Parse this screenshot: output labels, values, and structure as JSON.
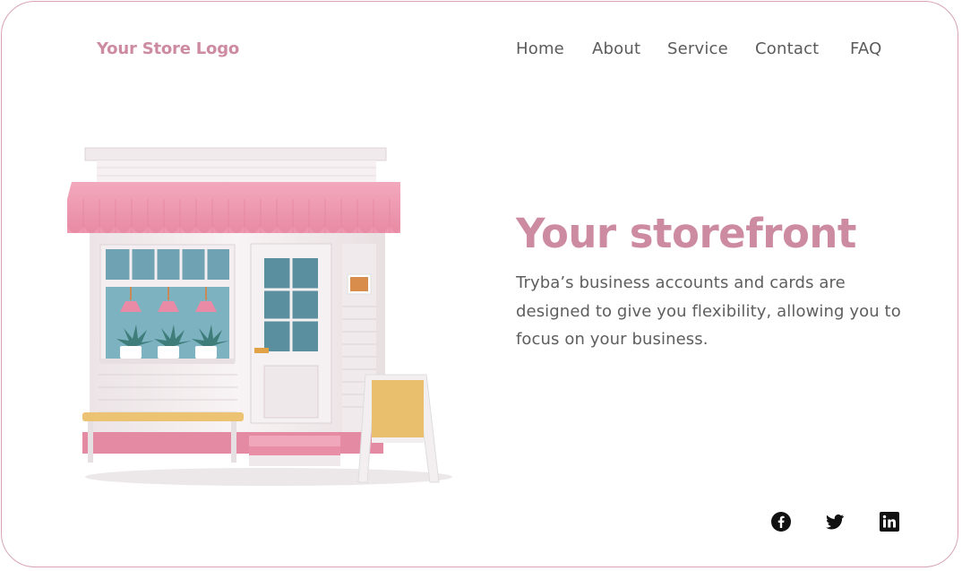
{
  "brand": {
    "logo_text": "Your Store Logo",
    "accent": "#cd8ba1"
  },
  "nav": {
    "items": [
      {
        "label": "Home"
      },
      {
        "label": "About"
      },
      {
        "label": "Service"
      },
      {
        "label": "Contact"
      },
      {
        "label": "FAQ"
      }
    ]
  },
  "hero": {
    "title": "Your storefront",
    "description": "Tryba’s business accounts and cards are designed to give you flexibility, allowing you to focus on your business.",
    "illustration": "storefront-illustration"
  },
  "social": [
    {
      "icon": "facebook-icon"
    },
    {
      "icon": "twitter-icon"
    },
    {
      "icon": "linkedin-icon"
    }
  ]
}
